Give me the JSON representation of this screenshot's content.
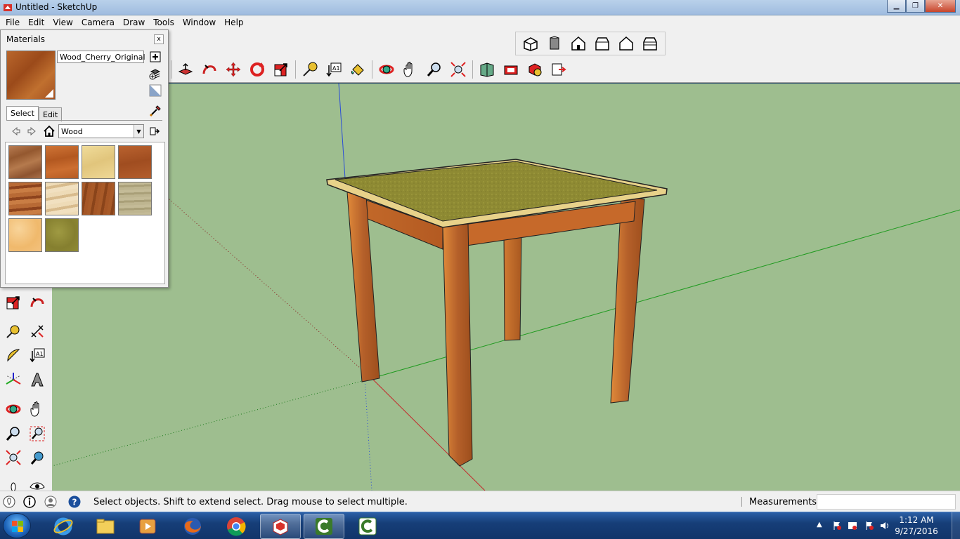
{
  "window": {
    "title": "Untitled - SketchUp",
    "controls": {
      "minimize": "minimize-icon",
      "maximize": "maximize-icon",
      "close": "close-icon"
    }
  },
  "menubar": {
    "items": [
      "File",
      "Edit",
      "View",
      "Camera",
      "Draw",
      "Tools",
      "Window",
      "Help"
    ]
  },
  "toolbars": {
    "views": [
      "iso-view-icon",
      "top-view-icon",
      "front-view-icon",
      "right-view-icon",
      "back-view-icon",
      "left-view-icon"
    ],
    "main": [
      "push-pull-icon",
      "follow-me-icon",
      "move-icon",
      "rotate-icon",
      "scale-icon",
      "tape-measure-icon",
      "text-icon",
      "paint-bucket-icon",
      "orbit-icon",
      "pan-icon",
      "zoom-icon",
      "zoom-extents-icon",
      "3d-warehouse-icon",
      "extension-warehouse-icon",
      "components-icon",
      "send-to-layout-icon"
    ],
    "left": [
      "scale-icon",
      "follow-me-icon",
      "tape-measure-icon",
      "dimension-icon",
      "protractor-icon",
      "text-icon",
      "axes-icon",
      "3d-text-icon",
      "orbit-icon",
      "pan-icon",
      "zoom-icon",
      "zoom-window-icon",
      "zoom-extents-icon",
      "previous-view-icon",
      "walk-icon",
      "look-around-icon"
    ]
  },
  "materials_panel": {
    "title": "Materials",
    "close_label": "x",
    "material_name": "Wood_Cherry_Original",
    "tabs": [
      "Select",
      "Edit"
    ],
    "active_tab": "Select",
    "collection": "Wood",
    "colors": {
      "current": "#a9531f",
      "swatches": [
        "#a46a43",
        "#c0662a",
        "#e8cf8b",
        "#b0582a",
        "#a5562c",
        "#e8cfa6",
        "#9d5024",
        "#b9b08b",
        "#f3c27e",
        "#8f8a34"
      ]
    }
  },
  "statusbar": {
    "hint": "Select objects. Shift to extend select. Drag mouse to select multiple.",
    "measurements_label": "Measurements",
    "measurements_value": ""
  },
  "taskbar": {
    "apps": [
      "internet-explorer-icon",
      "file-explorer-icon",
      "media-player-icon",
      "firefox-icon",
      "chrome-icon",
      "sketchup-icon",
      "camtasia-recorder-icon",
      "camtasia-studio-icon"
    ],
    "active_app": "sketchup-icon",
    "clock_time": "1:12 AM",
    "clock_date": "9/27/2016"
  },
  "viewport": {
    "background": "#9ebe8f",
    "axis_colors": {
      "red": "#c4262a",
      "green": "#1f9a1f",
      "blue": "#2a4dd8"
    }
  }
}
